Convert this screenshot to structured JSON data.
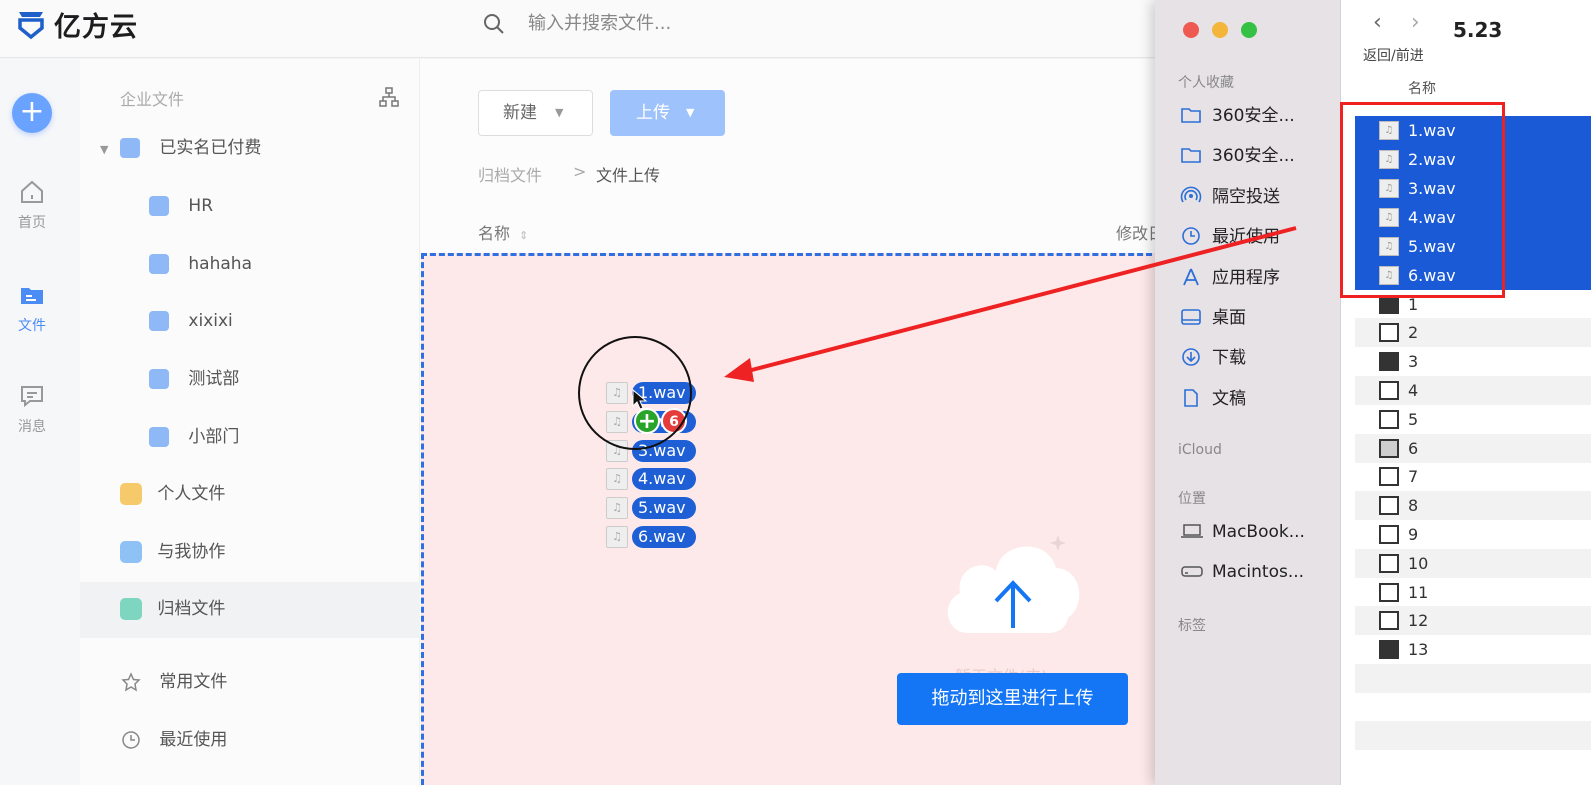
{
  "app": {
    "logo_text": "亿方云",
    "search_placeholder": "输入并搜索文件..."
  },
  "rail": [
    {
      "label": "首页",
      "icon": "home-icon"
    },
    {
      "label": "文件",
      "icon": "folder-icon"
    },
    {
      "label": "消息",
      "icon": "message-icon"
    }
  ],
  "tree": {
    "header": "企业文件",
    "root": "已实名已付费",
    "departments": [
      "HR",
      "hahaha",
      "xixixi",
      "测试部",
      "小部门"
    ],
    "personal": "个人文件",
    "shared": "与我协作",
    "archive": "归档文件",
    "favorites": "常用文件",
    "recent": "最近使用"
  },
  "toolbar": {
    "new_label": "新建",
    "upload_label": "上传"
  },
  "breadcrumb": {
    "root": "归档文件",
    "separator": ">",
    "current": "文件上传"
  },
  "columns": {
    "name": "名称",
    "modified": "修改日"
  },
  "drop": {
    "hint": "暂无文件(夹)",
    "button": "拖动到这里进行上传"
  },
  "drag": {
    "files": [
      "1.wav",
      "2.wav",
      "3.wav",
      "4.wav",
      "5.wav",
      "6.wav"
    ],
    "badge_plus": "+",
    "badge_count": "6"
  },
  "finder": {
    "title": "5.23",
    "nav_label": "返回/前进",
    "favorites_header": "个人收藏",
    "favorites": [
      "360安全...",
      "360安全...",
      "隔空投送",
      "最近使用",
      "应用程序",
      "桌面",
      "下载",
      "文稿"
    ],
    "icloud_header": "iCloud",
    "locations_header": "位置",
    "locations": [
      "MacBook...",
      "Macintos..."
    ],
    "tags_header": "标签",
    "column_name": "名称",
    "selected_files": [
      "1.wav",
      "2.wav",
      "3.wav",
      "4.wav",
      "5.wav",
      "6.wav"
    ],
    "other_files": [
      "1",
      "2",
      "3",
      "4",
      "5",
      "6",
      "7",
      "8",
      "9",
      "10",
      "11",
      "12",
      "13"
    ]
  },
  "colors": {
    "accent": "#1476f5",
    "selection": "#1a5ad6",
    "annotation": "#ee2222",
    "drop_bg": "#fde9e9"
  }
}
